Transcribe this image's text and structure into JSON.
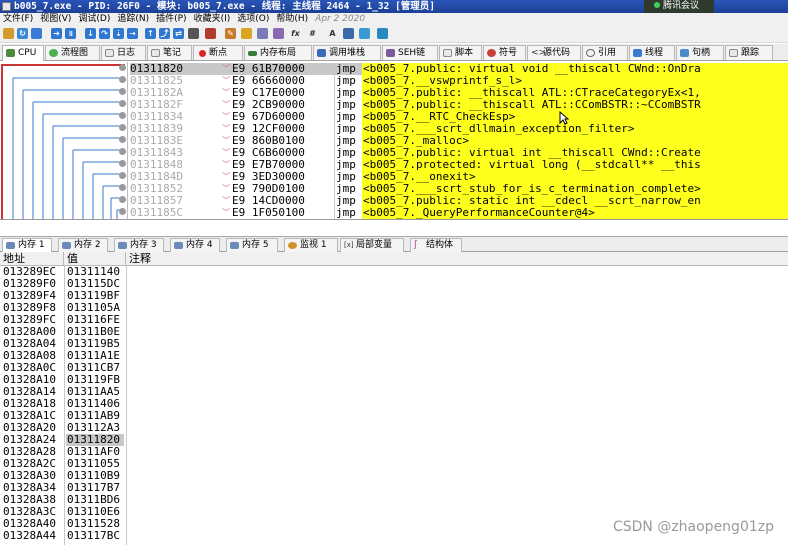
{
  "window": {
    "title": "b005_7.exe - PID: 26F0 - 模块: b005_7.exe - 线程: 主线程 2464 - 1_32 [管理员]",
    "tray_label": "腾讯会议"
  },
  "menu": {
    "items": [
      "文件(F)",
      "视图(V)",
      "调试(D)",
      "追踪(N)",
      "插件(P)",
      "收藏夹(I)",
      "选项(O)",
      "帮助(H)"
    ],
    "date": "Apr 2 2020"
  },
  "tabs_top": [
    "CPU",
    "流程图",
    "日志",
    "笔记",
    "断点",
    "内存布局",
    "调用堆栈",
    "SEH链",
    "脚本",
    "符号",
    "源代码",
    "引用",
    "线程",
    "句柄",
    "跟踪"
  ],
  "disasm": {
    "rows": [
      {
        "addr": "01311820",
        "bytes": "E9 61B70000",
        "mn": "jmp",
        "op": "<b005_7.public: virtual void __thiscall CWnd::OnDra",
        "selected": true
      },
      {
        "addr": "01311825",
        "bytes": "E9 66660000",
        "mn": "jmp",
        "op": "<b005_7.__vswprintf_s_l>",
        "selected": false
      },
      {
        "addr": "0131182A",
        "bytes": "E9 C17E0000",
        "mn": "jmp",
        "op": "<b005_7.public: __thiscall ATL::CTraceCategoryEx<1,",
        "selected": false
      },
      {
        "addr": "0131182F",
        "bytes": "E9 2CB90000",
        "mn": "jmp",
        "op": "<b005_7.public: __thiscall ATL::CComBSTR::~CComBSTR",
        "selected": false
      },
      {
        "addr": "01311834",
        "bytes": "E9 67D60000",
        "mn": "jmp",
        "op": "<b005_7.__RTC_CheckEsp>",
        "selected": false
      },
      {
        "addr": "01311839",
        "bytes": "E9 12CF0000",
        "mn": "jmp",
        "op": "<b005_7.___scrt_dllmain_exception_filter>",
        "selected": false
      },
      {
        "addr": "0131183E",
        "bytes": "E9 860B0100",
        "mn": "jmp",
        "op": "<b005_7._malloc>",
        "selected": false
      },
      {
        "addr": "01311843",
        "bytes": "E9 C6B60000",
        "mn": "jmp",
        "op": "<b005_7.public: virtual int __thiscall CWnd::Create",
        "selected": false
      },
      {
        "addr": "01311848",
        "bytes": "E9 E7B70000",
        "mn": "jmp",
        "op": "<b005_7.protected: virtual long (__stdcall** __this",
        "selected": false
      },
      {
        "addr": "0131184D",
        "bytes": "E9 3ED30000",
        "mn": "jmp",
        "op": "<b005_7.__onexit>",
        "selected": false
      },
      {
        "addr": "01311852",
        "bytes": "E9 790D0100",
        "mn": "jmp",
        "op": "<b005_7.___scrt_stub_for_is_c_termination_complete>",
        "selected": false
      },
      {
        "addr": "01311857",
        "bytes": "E9 14CD0000",
        "mn": "jmp",
        "op": "<b005_7.public: static int __cdecl __scrt_narrow_en",
        "selected": false
      },
      {
        "addr": "0131185C",
        "bytes": "E9 1F050100",
        "mn": "jmp",
        "op": "<b005_7._QueryPerformanceCounter@4>",
        "selected": false
      }
    ]
  },
  "tabs_bottom": [
    "内存 1",
    "内存 2",
    "内存 3",
    "内存 4",
    "内存 5",
    "监视 1",
    "局部变量",
    "结构体"
  ],
  "memory": {
    "headers": {
      "addr": "地址",
      "value": "值",
      "comment": "注释"
    },
    "rows": [
      {
        "addr": "013289EC",
        "value": "01311140",
        "selected": false
      },
      {
        "addr": "013289F0",
        "value": "013115DC",
        "selected": false
      },
      {
        "addr": "013289F4",
        "value": "013119BF",
        "selected": false
      },
      {
        "addr": "013289F8",
        "value": "0131105A",
        "selected": false
      },
      {
        "addr": "013289FC",
        "value": "013116FE",
        "selected": false
      },
      {
        "addr": "01328A00",
        "value": "01311B0E",
        "selected": false
      },
      {
        "addr": "01328A04",
        "value": "013119B5",
        "selected": false
      },
      {
        "addr": "01328A08",
        "value": "01311A1E",
        "selected": false
      },
      {
        "addr": "01328A0C",
        "value": "01311CB7",
        "selected": false
      },
      {
        "addr": "01328A10",
        "value": "013119FB",
        "selected": false
      },
      {
        "addr": "01328A14",
        "value": "01311AA5",
        "selected": false
      },
      {
        "addr": "01328A18",
        "value": "01311406",
        "selected": false
      },
      {
        "addr": "01328A1C",
        "value": "01311AB9",
        "selected": false
      },
      {
        "addr": "01328A20",
        "value": "013112A3",
        "selected": false
      },
      {
        "addr": "01328A24",
        "value": "01311820",
        "selected": true
      },
      {
        "addr": "01328A28",
        "value": "01311AF0",
        "selected": false
      },
      {
        "addr": "01328A2C",
        "value": "01311055",
        "selected": false
      },
      {
        "addr": "01328A30",
        "value": "013110B9",
        "selected": false
      },
      {
        "addr": "01328A34",
        "value": "013117B7",
        "selected": false
      },
      {
        "addr": "01328A38",
        "value": "01311BD6",
        "selected": false
      },
      {
        "addr": "01328A3C",
        "value": "013110E6",
        "selected": false
      },
      {
        "addr": "01328A40",
        "value": "01311528",
        "selected": false
      },
      {
        "addr": "01328A44",
        "value": "013117BC",
        "selected": false
      }
    ]
  },
  "watermark": "CSDN @zhaopeng01zp",
  "colors": {
    "highlight": "#ffff1e",
    "selection": "#c8c8c8",
    "arrow": "#cc3333"
  }
}
